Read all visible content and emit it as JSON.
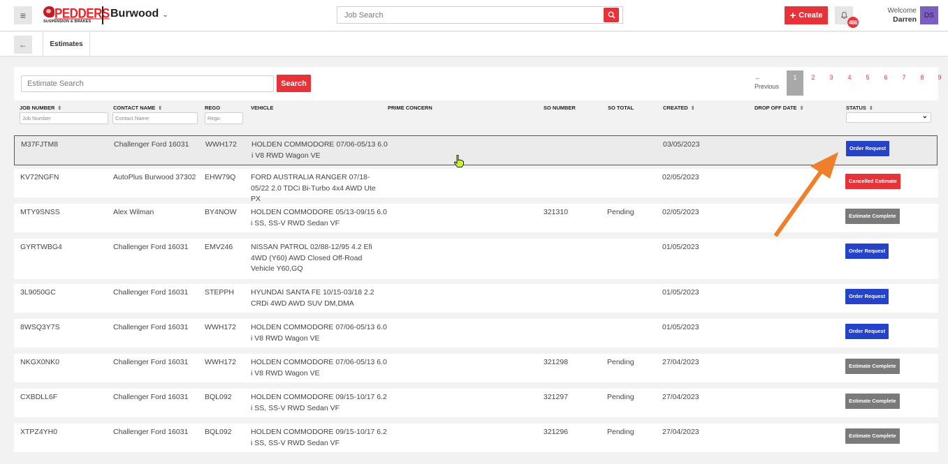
{
  "header": {
    "menu_icon": "hamburger-icon",
    "logo": {
      "brand": "PEDDERS",
      "tagline": "SUSPENSION & BRAKES"
    },
    "location": "Burwood",
    "job_search": {
      "placeholder": "Job Search",
      "value": ""
    },
    "create_label": "Create",
    "notifications": {
      "icon": "bell-icon",
      "count": "466"
    },
    "welcome_label": "Welcome",
    "user_name": "Darren",
    "user_initials": "DS"
  },
  "colors": {
    "accent": "#e8323a",
    "avatar": "#7b5ec0",
    "status_order_request": "#2443c9",
    "status_cancelled": "#e8323a",
    "status_complete": "#7a7a7a",
    "annotation_arrow": "#f07f2b"
  },
  "subbar": {
    "back_icon": "arrow-left-icon",
    "tab_label": "Estimates"
  },
  "search": {
    "placeholder": "Estimate Search",
    "value": "",
    "button_label": "Search"
  },
  "pagination": {
    "previous_label": "Previous",
    "pages": [
      "1",
      "2",
      "3",
      "4",
      "5",
      "6",
      "7",
      "8",
      "9"
    ],
    "current": "1"
  },
  "table": {
    "columns": [
      {
        "label": "JOB NUMBER",
        "sortable": true,
        "filter_placeholder": "Job Number"
      },
      {
        "label": "CONTACT NAME",
        "sortable": true,
        "filter_placeholder": "Contact Name"
      },
      {
        "label": "REGO",
        "sortable": false,
        "filter_placeholder": "Rego"
      },
      {
        "label": "VEHICLE",
        "sortable": false
      },
      {
        "label": "PRIME CONCERN",
        "sortable": false
      },
      {
        "label": "SO NUMBER",
        "sortable": false
      },
      {
        "label": "SO TOTAL",
        "sortable": false
      },
      {
        "label": "CREATED",
        "sortable": true
      },
      {
        "label": "DROP OFF DATE",
        "sortable": true
      },
      {
        "label": "STATUS",
        "sortable": true,
        "filter_value": ""
      }
    ],
    "rows": [
      {
        "job": "M37FJTM8",
        "contact": "Challenger Ford 16031",
        "rego": "WWH172",
        "vehicle": "HOLDEN COMMODORE 07/06-05/13 6.0 i V8 RWD Wagon VE",
        "prime": "",
        "so_number": "",
        "so_total": "",
        "created": "03/05/2023",
        "drop_off": "",
        "status": "Order Request",
        "status_type": "order"
      },
      {
        "job": "KV72NGFN",
        "contact": "AutoPlus Burwood 37302",
        "rego": "EHW79Q",
        "vehicle": "FORD AUSTRALIA RANGER 07/18-05/22 2.0 TDCi Bi-Turbo 4x4 AWD Ute PX",
        "prime": "",
        "so_number": "",
        "so_total": "",
        "created": "02/05/2023",
        "drop_off": "",
        "status": "Cancelled Estimate",
        "status_type": "cancelled"
      },
      {
        "job": "MTY9SNSS",
        "contact": "Alex Wilman",
        "rego": "BY4NOW",
        "vehicle": "HOLDEN COMMODORE 05/13-09/15 6.0 i SS, SS-V RWD Sedan VF",
        "prime": "",
        "so_number": "321310",
        "so_total": "Pending",
        "created": "02/05/2023",
        "drop_off": "",
        "status": "Estimate Complete",
        "status_type": "complete"
      },
      {
        "job": "GYRTWBG4",
        "contact": "Challenger Ford 16031",
        "rego": "EMV246",
        "vehicle": "NISSAN PATROL 02/88-12/95 4.2 Efi 4WD (Y60) AWD Closed Off-Road Vehicle Y60,GQ",
        "prime": "",
        "so_number": "",
        "so_total": "",
        "created": "01/05/2023",
        "drop_off": "",
        "status": "Order Request",
        "status_type": "order"
      },
      {
        "job": "3L9050GC",
        "contact": "Challenger Ford 16031",
        "rego": "STEPPH",
        "vehicle": "HYUNDAI SANTA FE 10/15-03/18 2.2 CRDi 4WD AWD SUV DM,DMA",
        "prime": "",
        "so_number": "",
        "so_total": "",
        "created": "01/05/2023",
        "drop_off": "",
        "status": "Order Request",
        "status_type": "order"
      },
      {
        "job": "8WSQ3Y7S",
        "contact": "Challenger Ford 16031",
        "rego": "WWH172",
        "vehicle": "HOLDEN COMMODORE 07/06-05/13 6.0 i V8 RWD Wagon VE",
        "prime": "",
        "so_number": "",
        "so_total": "",
        "created": "01/05/2023",
        "drop_off": "",
        "status": "Order Request",
        "status_type": "order"
      },
      {
        "job": "NKGX0NK0",
        "contact": "Challenger Ford 16031",
        "rego": "WWH172",
        "vehicle": "HOLDEN COMMODORE 07/06-05/13 6.0 i V8 RWD Wagon VE",
        "prime": "",
        "so_number": "321298",
        "so_total": "Pending",
        "created": "27/04/2023",
        "drop_off": "",
        "status": "Estimate Complete",
        "status_type": "complete"
      },
      {
        "job": "CXBDLL6F",
        "contact": "Challenger Ford 16031",
        "rego": "BQL092",
        "vehicle": "HOLDEN COMMODORE 09/15-10/17 6.2 i SS, SS-V RWD Sedan VF",
        "prime": "",
        "so_number": "321297",
        "so_total": "Pending",
        "created": "27/04/2023",
        "drop_off": "",
        "status": "Estimate Complete",
        "status_type": "complete"
      },
      {
        "job": "XTPZ4YH0",
        "contact": "Challenger Ford 16031",
        "rego": "BQL092",
        "vehicle": "HOLDEN COMMODORE 09/15-10/17 6.2 i SS, SS-V RWD Sedan VF",
        "prime": "",
        "so_number": "321296",
        "so_total": "Pending",
        "created": "27/04/2023",
        "drop_off": "",
        "status": "Estimate Complete",
        "status_type": "complete"
      }
    ]
  }
}
